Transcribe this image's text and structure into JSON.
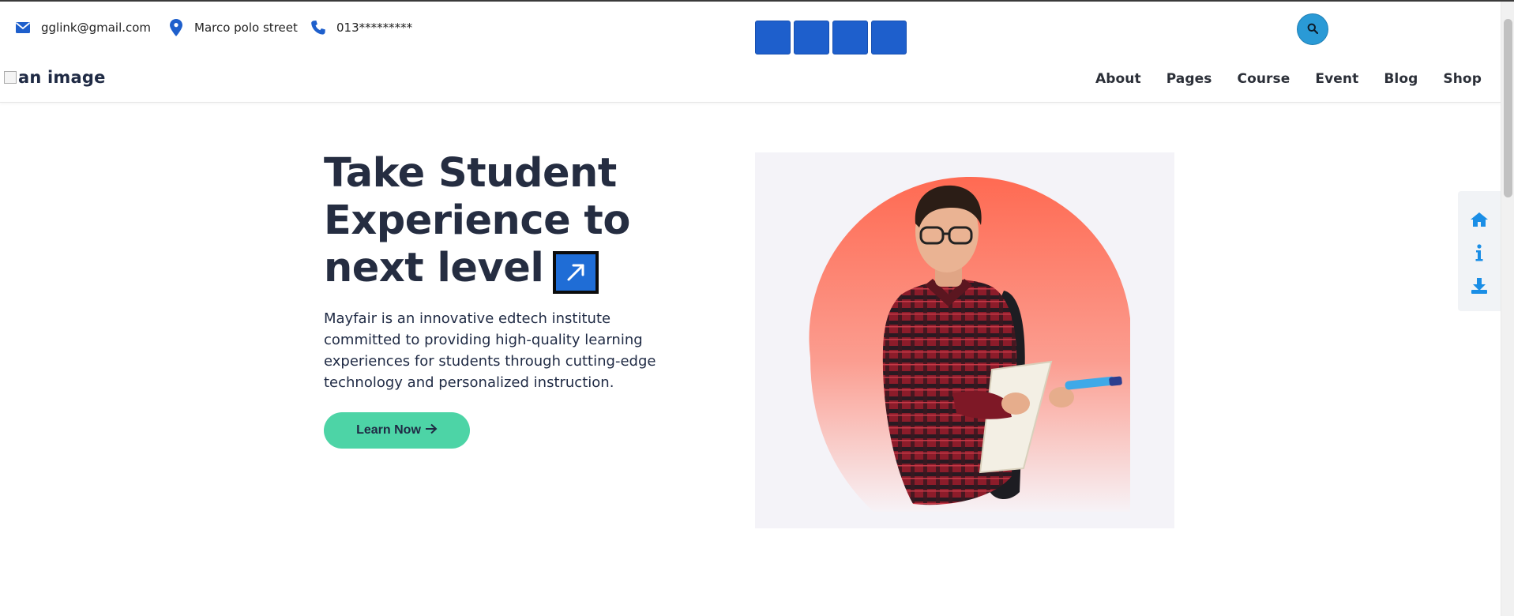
{
  "contact": {
    "email": "gglink@gmail.com",
    "address": "Marco polo street",
    "phone": "013*********"
  },
  "social": {
    "count": 4,
    "color": "#1e5fcc"
  },
  "search": {
    "icon": "search-icon"
  },
  "logo": {
    "alt_text": "an image"
  },
  "nav": {
    "items": [
      {
        "label": "About"
      },
      {
        "label": "Pages"
      },
      {
        "label": "Course"
      },
      {
        "label": "Event"
      },
      {
        "label": "Blog"
      },
      {
        "label": "Shop"
      }
    ]
  },
  "hero": {
    "title_line1": "Take Student",
    "title_line2": "Experience to",
    "title_line3": "next level",
    "description": "Mayfair is an innovative edtech institute committed to providing high-quality learning experiences for students through cutting-edge technology and personalized instruction.",
    "cta_label": "Learn Now",
    "cta_icon": "arrow-right-icon",
    "badge_icon": "arrow-up-right-icon"
  },
  "side_panel": {
    "icons": [
      "home-icon",
      "info-icon",
      "download-icon"
    ]
  },
  "colors": {
    "accent": "#1e5fcc",
    "cta": "#4dd4a6",
    "heading": "#252d41",
    "side_icon": "#1a8ee6"
  }
}
